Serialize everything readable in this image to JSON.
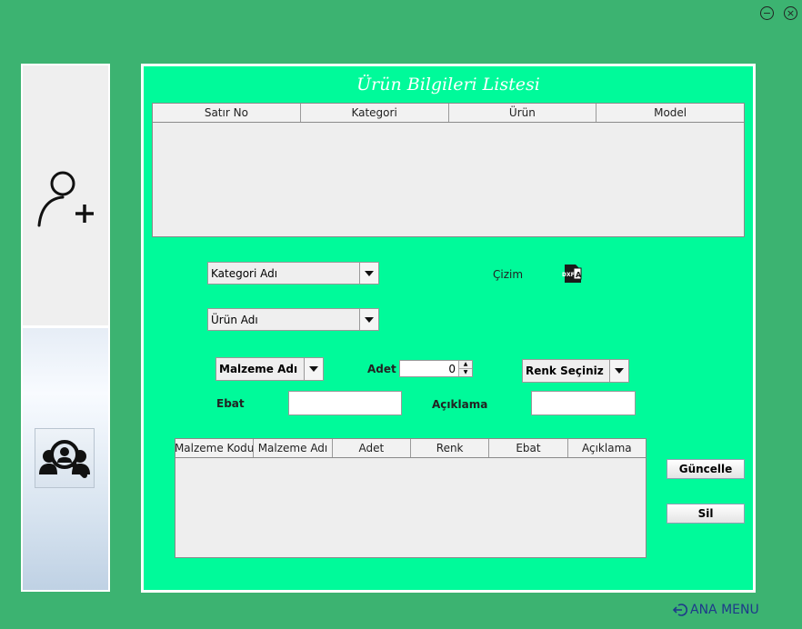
{
  "window": {
    "minimize_icon": "minus-circle-icon",
    "close_icon": "x-circle-icon"
  },
  "sidebar": {
    "add_user_icon": "person-add-icon",
    "search_users_icon": "people-search-icon"
  },
  "panel": {
    "title": "Ürün Bilgileri Listesi",
    "main_table": {
      "columns": [
        "Satır No",
        "Kategori",
        "Ürün",
        "Model"
      ],
      "rows": []
    },
    "category_combo": "Kategori Adı",
    "product_combo": "Ürün Adı",
    "drawing_label": "Çizim",
    "drawing_icon": "dxf-file-icon",
    "drawing_icon_text": "DXF",
    "material_combo": "Malzeme Adı",
    "quantity_label": "Adet",
    "quantity_value": "0",
    "color_combo": "Renk Seçiniz",
    "size_label": "Ebat",
    "size_value": "",
    "description_label": "Açıklama",
    "description_value": "",
    "material_table": {
      "columns": [
        "Malzeme Kodu",
        "Malzeme Adı",
        "Adet",
        "Renk",
        "Ebat",
        "Açıklama"
      ],
      "rows": []
    },
    "update_button": "Güncelle",
    "delete_button": "Sil"
  },
  "footer": {
    "main_menu_label": "ANA MENU",
    "main_menu_icon": "sign-out-arrow-icon"
  }
}
